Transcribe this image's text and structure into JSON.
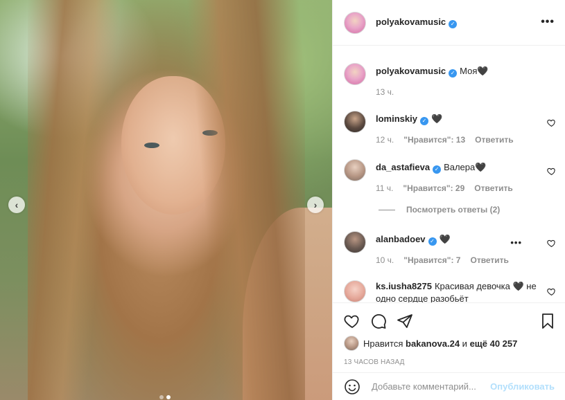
{
  "post": {
    "author": "polyakovamusic",
    "caption": "Моя🖤",
    "caption_time": "13 ч.",
    "more_menu": "•••"
  },
  "navigation": {
    "prev_arrow": "‹",
    "next_arrow": "›"
  },
  "comments": [
    {
      "user": "lominskiy",
      "verified": true,
      "text": "🖤",
      "time": "12 ч.",
      "likes": "\"Нравится\": 13",
      "reply": "Ответить"
    },
    {
      "user": "da_astafieva",
      "verified": true,
      "text": "Валера🖤",
      "time": "11 ч.",
      "likes": "\"Нравится\": 29",
      "reply": "Ответить",
      "view_replies": "Посмотреть ответы (2)"
    },
    {
      "user": "alanbadoev",
      "verified": true,
      "text": "🖤",
      "time": "10 ч.",
      "likes": "\"Нравится\": 7",
      "reply": "Ответить"
    },
    {
      "user": "ks.iusha8275",
      "verified": false,
      "text": "Красивая девочка 🖤 не одно сердце разобьёт"
    }
  ],
  "likes_summary": {
    "prefix": "Нравится",
    "user": "bakanova.24",
    "middle": "и",
    "others": "ещё 40 257"
  },
  "time_ago": "13 ЧАСОВ НАЗАД",
  "add_comment": {
    "placeholder": "Добавьте комментарий...",
    "publish_label": "Опубликовать"
  },
  "colors": {
    "verified": "#3897f0",
    "publish_disabled": "#b2dffc",
    "secondary_text": "#8e8e8e"
  }
}
